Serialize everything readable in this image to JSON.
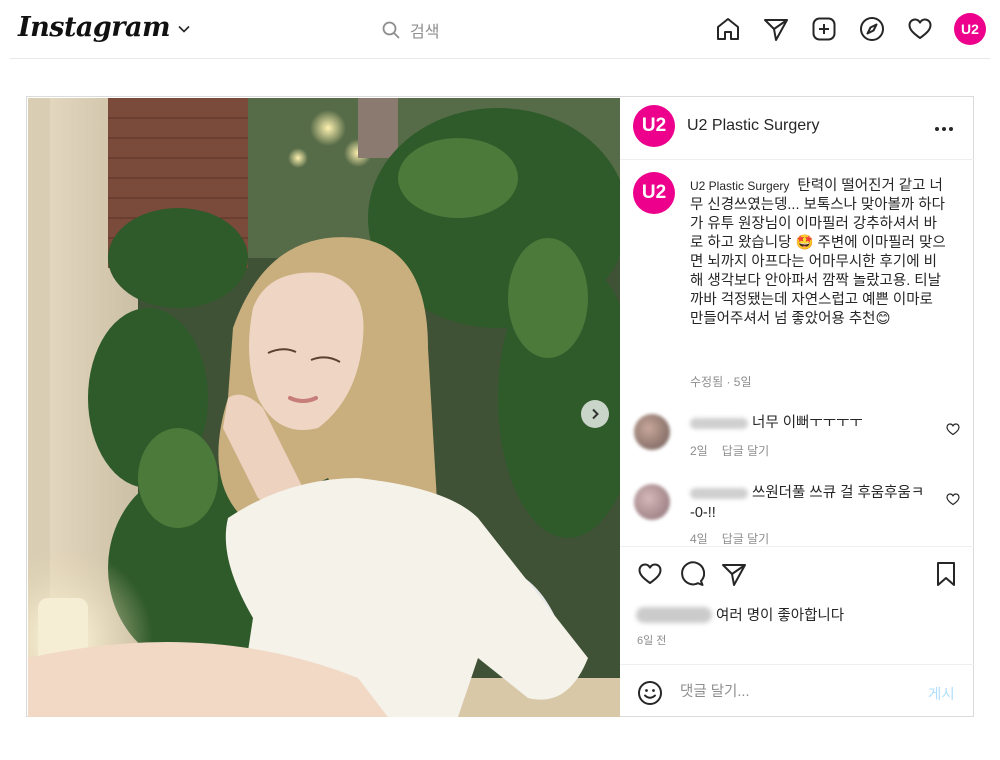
{
  "nav": {
    "logo": "Instagram",
    "search_placeholder": "검색",
    "avatar_text": "U2",
    "icons": [
      "home-icon",
      "direct-send-icon",
      "new-post-icon",
      "explore-compass-icon",
      "activity-heart-icon"
    ]
  },
  "post": {
    "account": "U2 Plastic Surgery",
    "avatar_text": "U2",
    "caption_user": "U2 Plastic Surgery",
    "caption_text": "탄력이 떨어진거 같고 너무 신경쓰였는뎅... 보톡스나 맞아볼까 하다가 유투 원장님이 이마필러 강추하셔서 바로 하고 왔습니당 🤩 주변에 이마필러 맞으면 뇌까지 아프다는 어마무시한 후기에 비해 생각보다 안아파서 깜짝 놀랐고용. 티날까바 걱정됐는데 자연스럽고 예쁜 이마로 만들어주셔서 넘 좋았어용 추천😊",
    "caption_meta": "수정됨 · 5일",
    "comments": [
      {
        "text": "너무 이뻐ㅜㅜㅜㅜ",
        "time": "2일",
        "reply": "답글 달기"
      },
      {
        "text": "쓰원더풀 쓰큐 걸 후움후움ㅋ -0-!!",
        "time": "4일",
        "reply": "답글 달기"
      }
    ],
    "likes_text": "여러 명이 좋아합니다",
    "posted_time": "6일 전",
    "add_comment_placeholder": "댓글 달기...",
    "post_button": "게시"
  },
  "colors": {
    "brand": "#ec008c",
    "text": "#262626",
    "muted": "#8e8e8e",
    "post_button": "#b2dffc",
    "border": "#dbdbdb"
  }
}
